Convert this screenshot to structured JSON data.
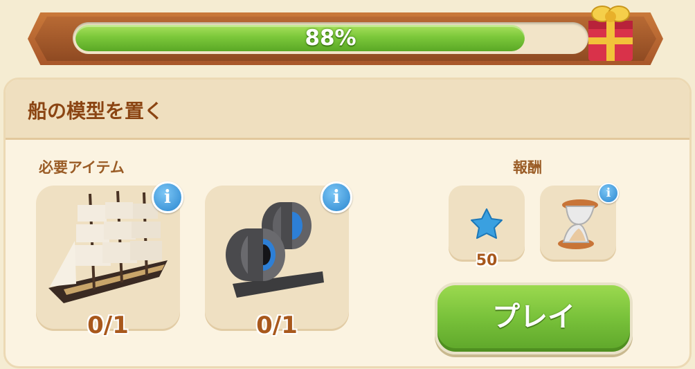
{
  "progress": {
    "label": "88%",
    "fraction": 0.88
  },
  "panel": {
    "title": "船の模型を置く",
    "required_label": "必要アイテム",
    "reward_label": "報酬",
    "required_items": [
      {
        "icon": "ship-model-icon",
        "count": "0/1"
      },
      {
        "icon": "tape-rolls-icon",
        "count": "0/1"
      }
    ],
    "rewards": [
      {
        "icon": "blue-star-icon",
        "amount": "50"
      },
      {
        "icon": "hourglass-icon"
      }
    ],
    "play_label": "プレイ"
  },
  "colors": {
    "accent_green": "#78c13a",
    "title_brown": "#8b4513",
    "info_blue": "#2a86cf"
  }
}
